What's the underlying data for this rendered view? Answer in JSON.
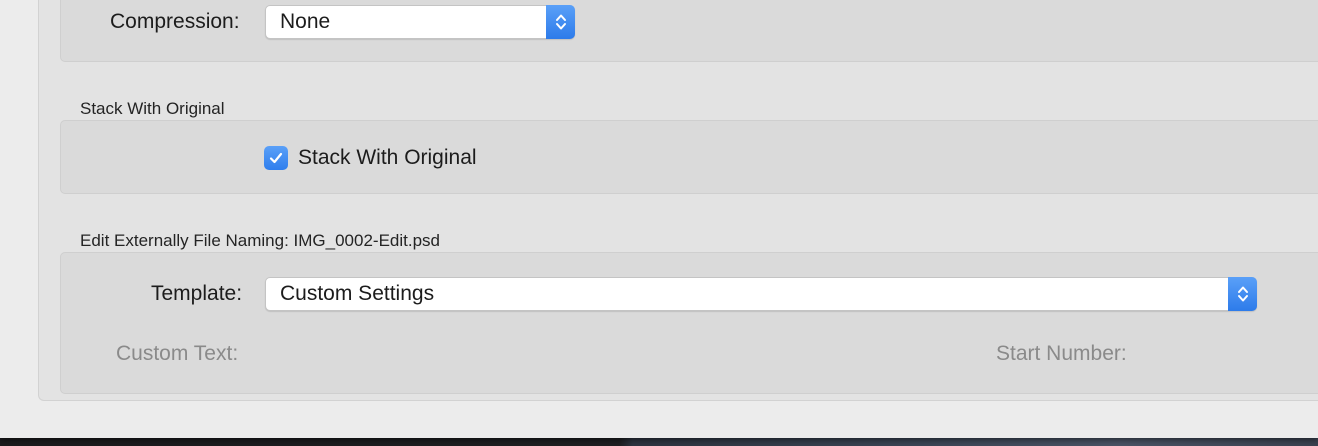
{
  "compression": {
    "label": "Compression:",
    "selected": "None"
  },
  "stack_section": {
    "title": "Stack With Original",
    "checkbox_label": "Stack With Original",
    "checked": true
  },
  "naming_section": {
    "title": "Edit Externally File Naming:  IMG_0002-Edit.psd",
    "template_label": "Template:",
    "template_selected": "Custom Settings",
    "custom_text_label": "Custom Text:",
    "start_number_label": "Start Number:"
  },
  "colors": {
    "accent": "#2f7eed",
    "panel": "#dadada",
    "disabled_text": "#8a8a8a"
  },
  "icons": {
    "popup_arrows": "chevron-up-down-icon",
    "checkmark": "checkmark-icon"
  }
}
